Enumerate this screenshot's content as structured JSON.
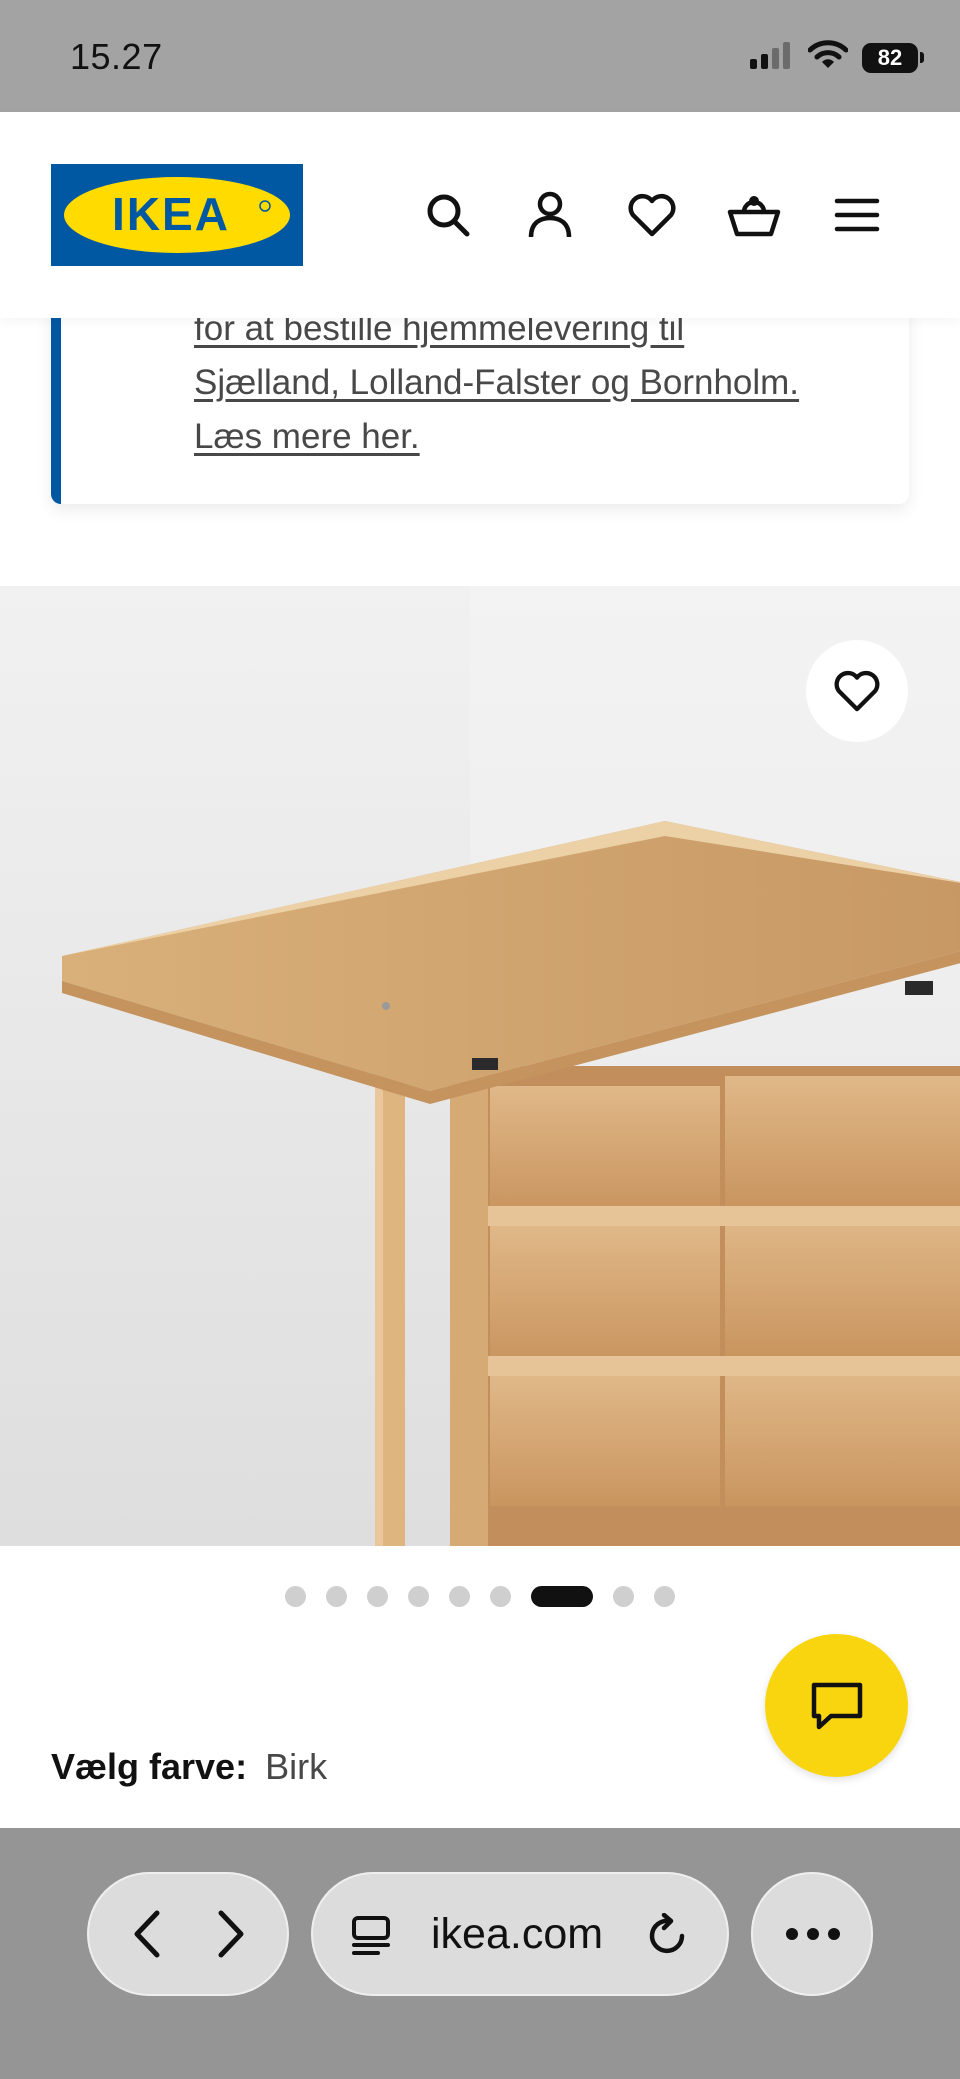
{
  "status_bar": {
    "time": "15.27",
    "battery": "82",
    "icons": [
      "signal-icon",
      "wifi-icon",
      "battery-icon"
    ]
  },
  "header": {
    "logo_text": "IKEA",
    "icons": [
      "search-icon",
      "account-icon",
      "favorites-heart-icon",
      "shopping-basket-icon",
      "menu-icon"
    ]
  },
  "notice": {
    "lines": [
      "for at bestille hjemmelevering til",
      "Sjælland, Lolland-Falster og Bornholm.",
      "Læs mere her."
    ]
  },
  "gallery": {
    "dots_total": 9,
    "active_index": 6
  },
  "product": {
    "color_label": "Vælg farve:",
    "color_value": "Birk"
  },
  "browser": {
    "url": "ikea.com",
    "icons": [
      "back-icon",
      "forward-icon",
      "reader-icon",
      "reload-icon",
      "more-icon"
    ]
  },
  "colors": {
    "ikea_blue": "#0058a3",
    "ikea_yellow": "#ffdb00",
    "chat_yellow": "#f8d50f"
  }
}
